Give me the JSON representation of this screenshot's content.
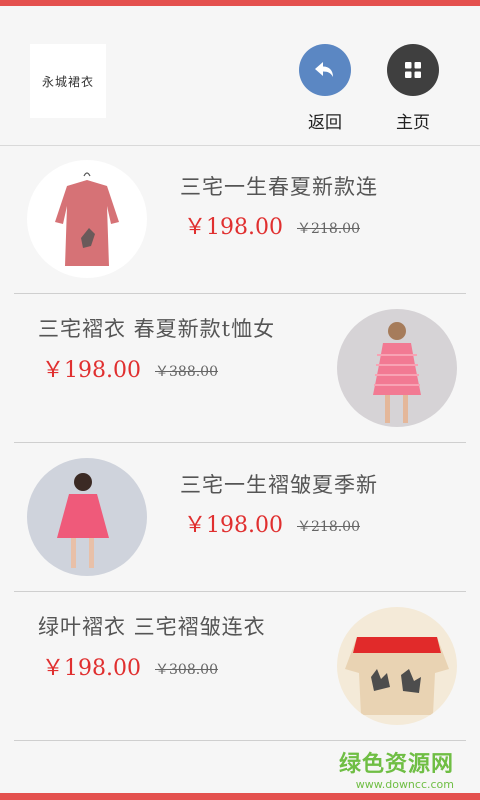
{
  "header": {
    "logo_text": "永城裙衣",
    "back_label": "返回",
    "home_label": "主页",
    "back_icon": "undo-arrow-icon",
    "home_icon": "grid-icon"
  },
  "products": [
    {
      "title": "三宅一生春夏新款连",
      "price": "￥198.00",
      "old_price": "￥218.00",
      "image": "pink-dress-on-hanger"
    },
    {
      "title": "三宅褶衣 春夏新款t恤女",
      "price": "￥198.00",
      "old_price": "￥388.00",
      "image": "model-pink-striped-dress"
    },
    {
      "title": "三宅一生褶皱夏季新",
      "price": "￥198.00",
      "old_price": "￥218.00",
      "image": "model-pink-pleated-dress"
    },
    {
      "title": "绿叶褶衣 三宅褶皱连衣",
      "price": "￥198.00",
      "old_price": "￥308.00",
      "image": "red-beige-printed-top"
    }
  ],
  "watermark": {
    "cn": "绿色资源网",
    "en": "www.downcc.com"
  },
  "colors": {
    "accent": "#e4514e",
    "price": "#e02f2f",
    "back_button": "#5b87c3",
    "home_button": "#3f3f3f",
    "watermark": "#6fbe44"
  }
}
